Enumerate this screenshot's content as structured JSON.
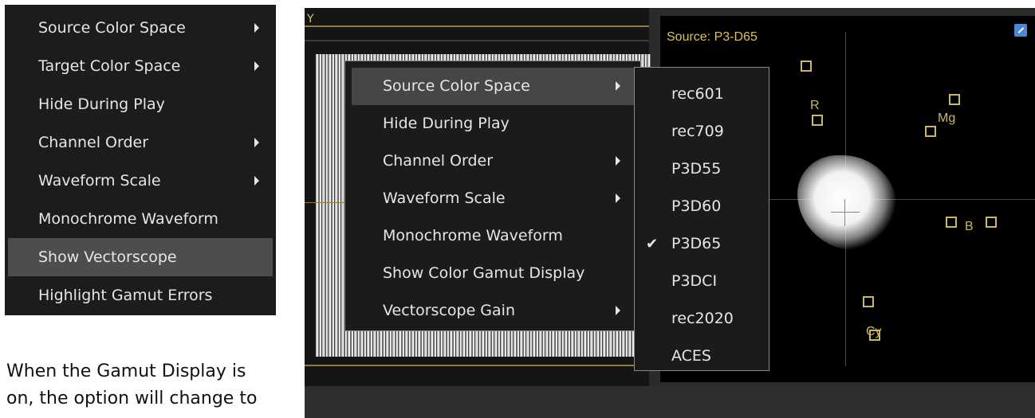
{
  "left_menu": {
    "items": [
      {
        "label": "Source Color Space",
        "submenu": true
      },
      {
        "label": "Target Color Space",
        "submenu": true
      },
      {
        "label": "Hide During Play",
        "submenu": false
      },
      {
        "label": "Channel Order",
        "submenu": true
      },
      {
        "label": "Waveform Scale",
        "submenu": true
      },
      {
        "label": "Monochrome Waveform",
        "submenu": false
      },
      {
        "label": "Show Vectorscope",
        "submenu": false,
        "highlighted": true
      },
      {
        "label": "Highlight Gamut Errors",
        "submenu": false
      }
    ]
  },
  "caption": {
    "line1": "When the Gamut Display is",
    "line2": "on, the option will change to"
  },
  "waveform": {
    "y_label": "Y"
  },
  "vectorscope": {
    "source_label": "Source: P3-D65",
    "targets": {
      "r": "R",
      "mg": "Mg",
      "b": "B",
      "cy": "Cy"
    }
  },
  "context_menu": {
    "items": [
      {
        "label": "Source Color Space",
        "submenu": true,
        "highlighted": true
      },
      {
        "label": "Hide During Play",
        "submenu": false
      },
      {
        "label": "Channel Order",
        "submenu": true
      },
      {
        "label": "Waveform Scale",
        "submenu": true
      },
      {
        "label": "Monochrome Waveform",
        "submenu": false
      },
      {
        "label": "Show Color Gamut Display",
        "submenu": false
      },
      {
        "label": "Vectorscope Gain",
        "submenu": true
      }
    ]
  },
  "submenu": {
    "items": [
      {
        "label": "rec601",
        "checked": false
      },
      {
        "label": "rec709",
        "checked": false
      },
      {
        "label": "P3D55",
        "checked": false
      },
      {
        "label": "P3D60",
        "checked": false
      },
      {
        "label": "P3D65",
        "checked": true
      },
      {
        "label": "P3DCI",
        "checked": false
      },
      {
        "label": "rec2020",
        "checked": false
      },
      {
        "label": "ACES",
        "checked": false
      }
    ],
    "check_glyph": "✔"
  },
  "colors": {
    "menu_bg": "#1b1b1b",
    "highlight": "#464646",
    "label_gold": "#d9c25a"
  }
}
